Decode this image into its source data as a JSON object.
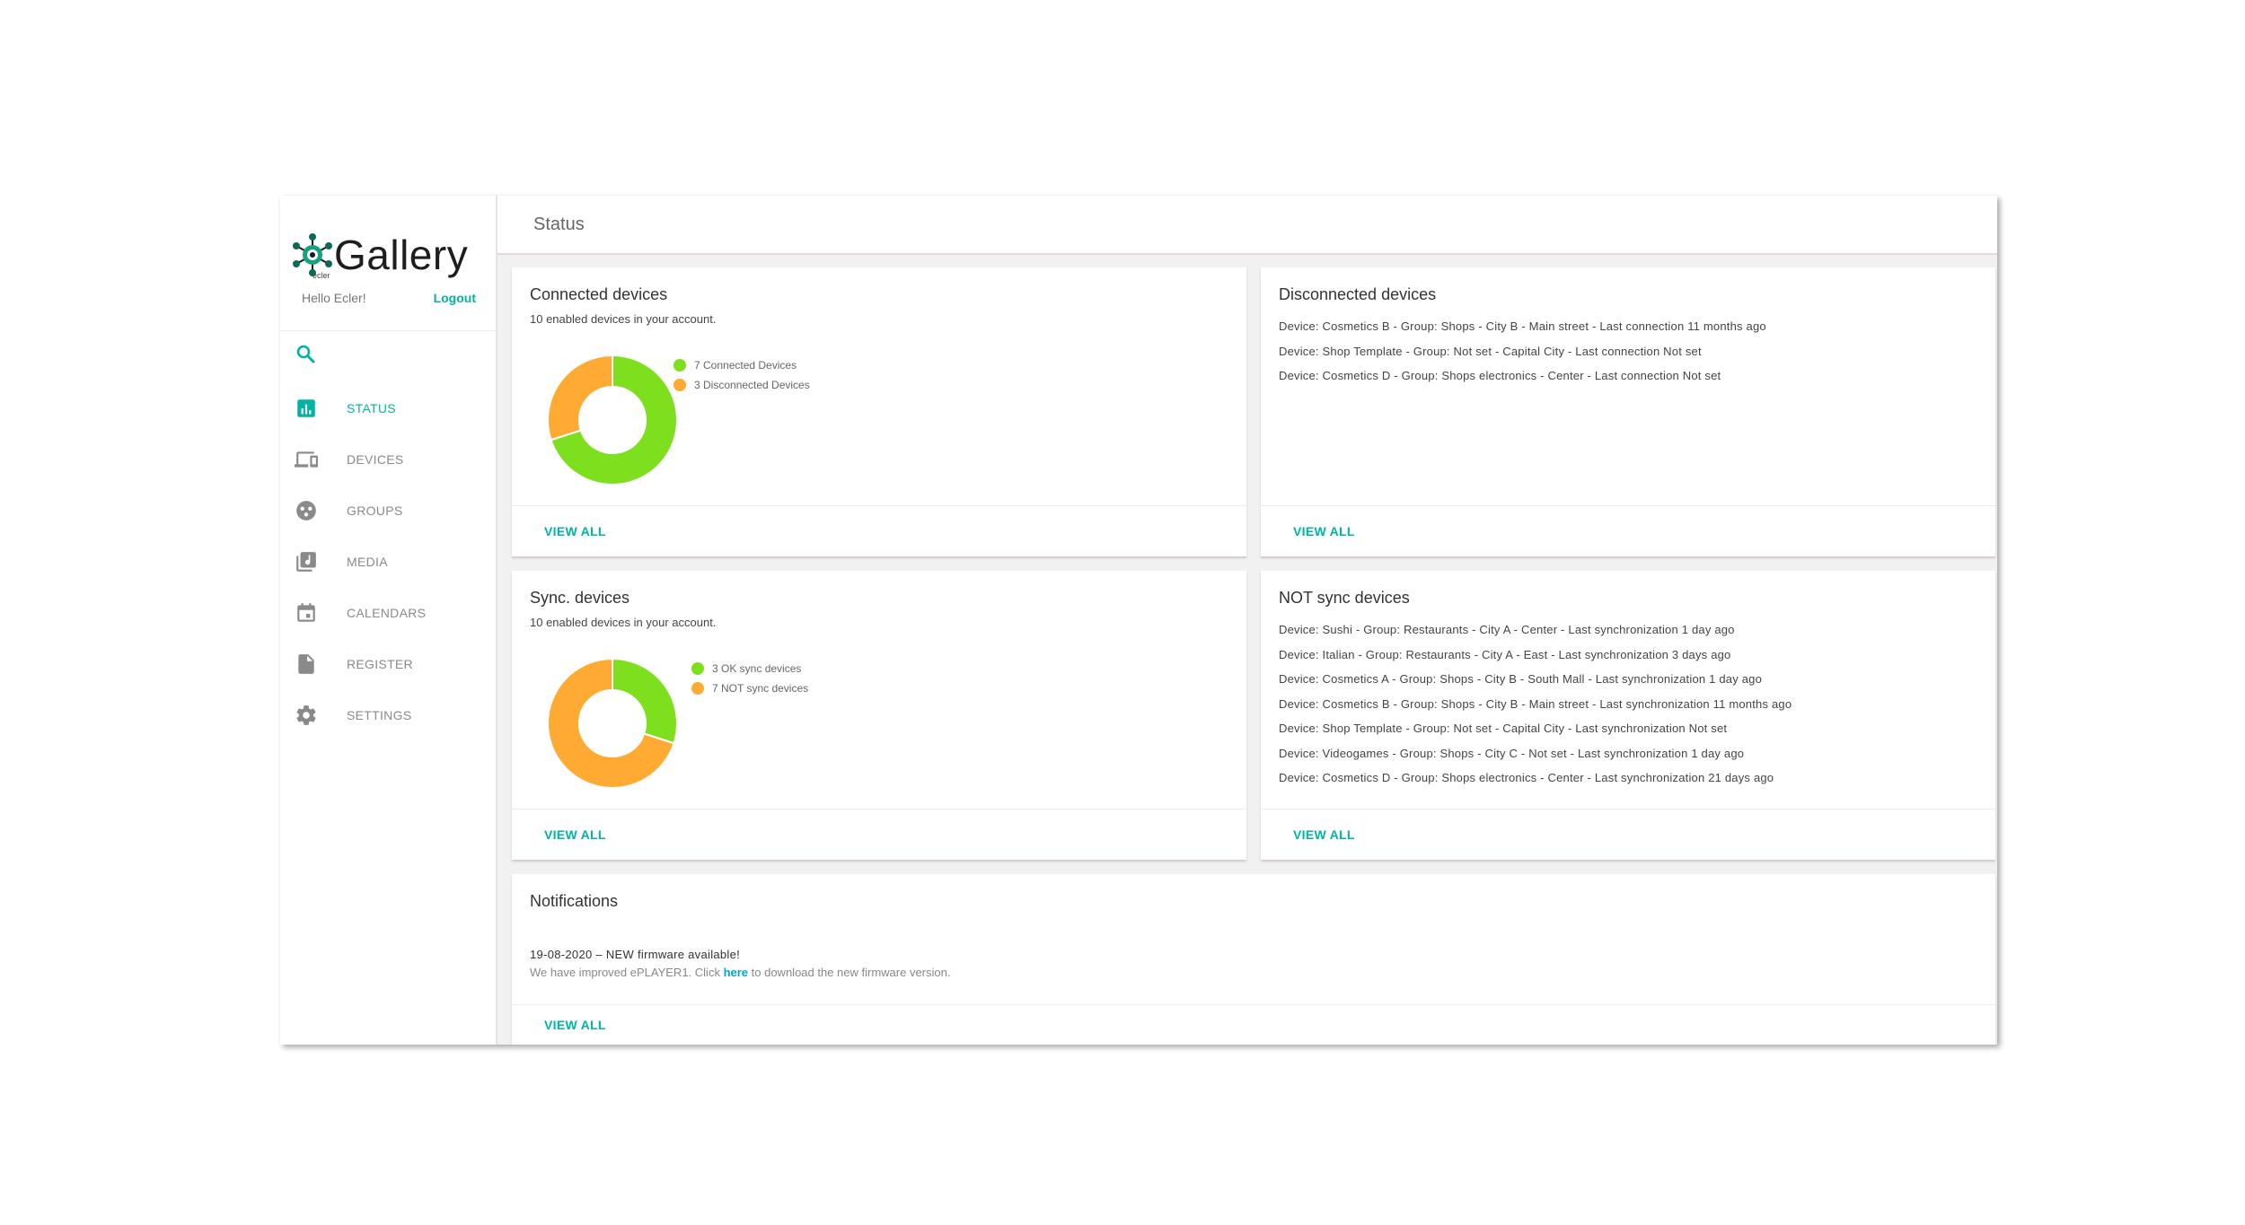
{
  "app": {
    "name": "Gallery",
    "sub": "ecler"
  },
  "user": {
    "greeting": "Hello Ecler!",
    "logout_label": "Logout"
  },
  "nav": [
    {
      "label": "STATUS",
      "icon": "bar-chart-icon",
      "active": true
    },
    {
      "label": "DEVICES",
      "icon": "devices-icon"
    },
    {
      "label": "GROUPS",
      "icon": "groups-icon"
    },
    {
      "label": "MEDIA",
      "icon": "media-library-icon"
    },
    {
      "label": "CALENDARS",
      "icon": "calendar-icon"
    },
    {
      "label": "REGISTER",
      "icon": "document-icon"
    },
    {
      "label": "SETTINGS",
      "icon": "gear-icon"
    }
  ],
  "page": {
    "title": "Status"
  },
  "colors": {
    "accent": "#00b3a4",
    "green": "#7ddf1e",
    "orange": "#ffab33"
  },
  "connected": {
    "title": "Connected devices",
    "subtitle": "10 enabled devices in your account.",
    "legend": [
      "7 Connected Devices",
      "3 Disconnected Devices"
    ],
    "view_all": "VIEW ALL"
  },
  "sync": {
    "title": "Sync. devices",
    "subtitle": "10 enabled devices in your account.",
    "legend": [
      "3 OK sync devices",
      "7 NOT sync devices"
    ],
    "view_all": "VIEW ALL"
  },
  "chart_data": [
    {
      "type": "pie",
      "categories": [
        "Connected Devices",
        "Disconnected Devices"
      ],
      "values": [
        7,
        3
      ],
      "colors": [
        "#7ddf1e",
        "#ffab33"
      ]
    },
    {
      "type": "pie",
      "categories": [
        "OK sync devices",
        "NOT sync devices"
      ],
      "values": [
        3,
        7
      ],
      "colors": [
        "#7ddf1e",
        "#ffab33"
      ]
    }
  ],
  "disconnected": {
    "title": "Disconnected devices",
    "items": [
      "Device: Cosmetics B - Group: Shops - City B - Main street - Last connection 11 months ago",
      "Device: Shop Template - Group: Not set - Capital City - Last connection Not set",
      "Device: Cosmetics D - Group: Shops electronics - Center - Last connection Not set"
    ],
    "view_all": "VIEW ALL"
  },
  "not_sync": {
    "title": "NOT sync devices",
    "items": [
      "Device: Sushi - Group: Restaurants - City A - Center - Last synchronization 1 day ago",
      "Device: Italian - Group: Restaurants - City A - East - Last synchronization 3 days ago",
      "Device: Cosmetics A - Group: Shops - City B - South Mall - Last synchronization 1 day ago",
      "Device: Cosmetics B - Group: Shops - City B - Main street - Last synchronization 11 months ago",
      "Device: Shop Template - Group: Not set - Capital City - Last synchronization Not set",
      "Device: Videogames - Group: Shops - City C - Not set - Last synchronization 1 day ago",
      "Device: Cosmetics D - Group: Shops electronics - Center - Last synchronization 21 days ago"
    ],
    "view_all": "VIEW ALL"
  },
  "notifications": {
    "title": "Notifications",
    "date_line": "19-08-2020 – NEW firmware available!",
    "msg_before": "We have improved ePLAYER1. Click ",
    "msg_link": "here",
    "msg_after": " to download the new firmware version.",
    "view_all": "VIEW ALL"
  }
}
